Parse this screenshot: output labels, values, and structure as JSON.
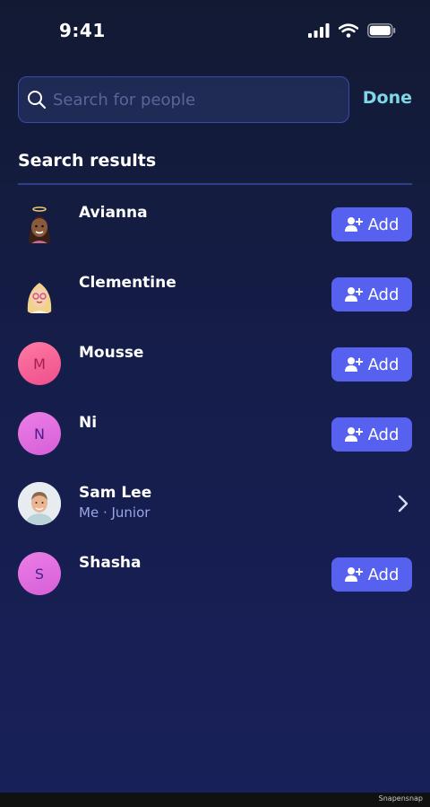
{
  "status_bar": {
    "time": "9:41"
  },
  "search": {
    "placeholder": "Search for people",
    "value": "",
    "done_label": "Done"
  },
  "section_title": "Search results",
  "results": [
    {
      "name": "Avianna",
      "subtitle": "",
      "action": "Add",
      "avatar": "bitmoji-avianna"
    },
    {
      "name": "Clementine",
      "subtitle": "",
      "action": "Add",
      "avatar": "bitmoji-clementine"
    },
    {
      "name": "Mousse",
      "subtitle": "",
      "action": "Add",
      "avatar_initial": "M"
    },
    {
      "name": "Ni",
      "subtitle": "",
      "action": "Add",
      "avatar_initial": "N"
    },
    {
      "name": "Sam Lee",
      "subtitle": "Me · Junior",
      "action": "chevron",
      "avatar": "photo-sam-lee"
    },
    {
      "name": "Shasha",
      "subtitle": "",
      "action": "Add",
      "avatar_initial": "S"
    }
  ],
  "colors": {
    "accent": "#5661f0",
    "done": "#7fd7e6",
    "divider": "#2f3d8c",
    "subtitle": "#9aa6e6"
  },
  "icons": [
    "search-icon",
    "signal-icon",
    "wifi-icon",
    "battery-icon",
    "add-person-icon",
    "chevron-right-icon"
  ],
  "footer": {
    "watermark": "Snapensnap"
  }
}
